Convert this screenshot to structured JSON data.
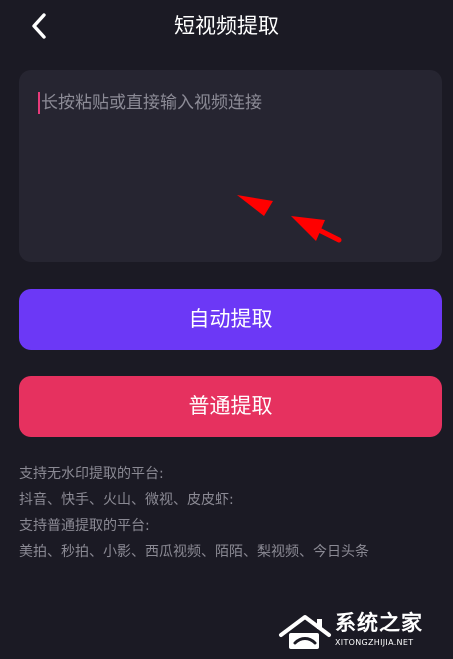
{
  "header": {
    "title": "短视频提取",
    "back_icon": "chevron-left-icon"
  },
  "input": {
    "placeholder": "长按粘贴或直接输入视频连接",
    "cursor_color": "#e73a7a"
  },
  "buttons": {
    "auto_extract": "自动提取",
    "normal_extract": "普通提取"
  },
  "info": {
    "lines": [
      "支持无水印提取的平台:",
      "抖音、快手、火山、微视、皮皮虾:",
      "支持普通提取的平台:",
      "美拍、秒拍、小影、西瓜视频、陌陌、梨视频、今日头条"
    ]
  },
  "watermark": {
    "title": "系统之家",
    "url": "XITONGZHIJIA.NET"
  },
  "colors": {
    "background": "#1b1a24",
    "input_bg": "#262531",
    "auto_button": "#6c38f6",
    "normal_button": "#e6315f",
    "annotation_arrow": "#ff0000"
  }
}
